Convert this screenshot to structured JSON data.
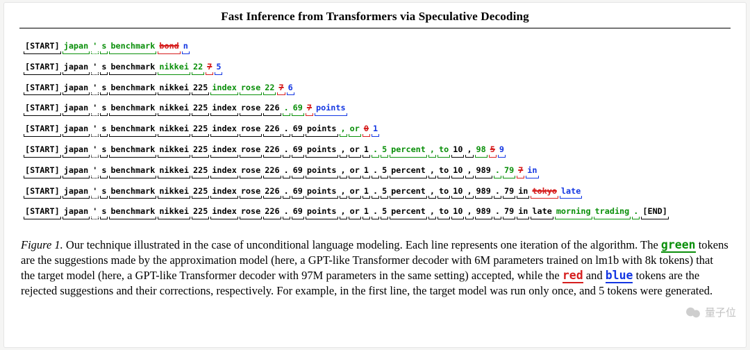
{
  "title": "Fast Inference from Transformers via Speculative Decoding",
  "watermark": "量子位",
  "caption": {
    "label": "Figure 1.",
    "parts": [
      " Our technique illustrated in the case of unconditional language modeling. Each line represents one iteration of the algorithm. The ",
      {
        "kw": "green",
        "color": "green"
      },
      " tokens are the suggestions made by the approximation model (here, a GPT-like Transformer decoder with 6M parameters trained on lm1b with 8k tokens) that the target model (here, a GPT-like Transformer decoder with 97M parameters in the same setting) accepted, while the ",
      {
        "kw": "red",
        "color": "red"
      },
      " and ",
      {
        "kw": "blue",
        "color": "blue"
      },
      " tokens are the rejected suggestions and their corrections, respectively. For example, in the first line, the target model was run only once, and 5 tokens were generated."
    ]
  },
  "lines": [
    [
      {
        "t": "[START]",
        "c": "black"
      },
      {
        "t": "japan",
        "c": "green"
      },
      {
        "t": "'",
        "c": "green",
        "dash": true
      },
      {
        "t": "s",
        "c": "green"
      },
      {
        "t": "benchmark",
        "c": "green"
      },
      {
        "t": "bond",
        "c": "red",
        "strike": true
      },
      {
        "t": "n",
        "c": "blue"
      }
    ],
    [
      {
        "t": "[START]",
        "c": "black"
      },
      {
        "t": "japan",
        "c": "black"
      },
      {
        "t": "'",
        "c": "black",
        "dash": true
      },
      {
        "t": "s",
        "c": "black"
      },
      {
        "t": "benchmark",
        "c": "black"
      },
      {
        "t": "nikkei",
        "c": "green"
      },
      {
        "t": "22",
        "c": "green"
      },
      {
        "t": "7",
        "c": "red",
        "strike": true
      },
      {
        "t": "5",
        "c": "blue"
      }
    ],
    [
      {
        "t": "[START]",
        "c": "black"
      },
      {
        "t": "japan",
        "c": "black"
      },
      {
        "t": "'",
        "c": "black",
        "dash": true
      },
      {
        "t": "s",
        "c": "black"
      },
      {
        "t": "benchmark",
        "c": "black"
      },
      {
        "t": "nikkei",
        "c": "black"
      },
      {
        "t": "225",
        "c": "black"
      },
      {
        "t": "index",
        "c": "green"
      },
      {
        "t": "rose",
        "c": "green"
      },
      {
        "t": "22",
        "c": "green"
      },
      {
        "t": "7",
        "c": "red",
        "strike": true
      },
      {
        "t": "6",
        "c": "blue"
      }
    ],
    [
      {
        "t": "[START]",
        "c": "black"
      },
      {
        "t": "japan",
        "c": "black"
      },
      {
        "t": "'",
        "c": "black",
        "dash": true
      },
      {
        "t": "s",
        "c": "black"
      },
      {
        "t": "benchmark",
        "c": "black"
      },
      {
        "t": "nikkei",
        "c": "black"
      },
      {
        "t": "225",
        "c": "black"
      },
      {
        "t": "index",
        "c": "black"
      },
      {
        "t": "rose",
        "c": "black"
      },
      {
        "t": "226",
        "c": "black"
      },
      {
        "t": ".",
        "c": "green"
      },
      {
        "t": "69",
        "c": "green"
      },
      {
        "t": "7",
        "c": "red",
        "strike": true
      },
      {
        "t": "points",
        "c": "blue"
      }
    ],
    [
      {
        "t": "[START]",
        "c": "black"
      },
      {
        "t": "japan",
        "c": "black"
      },
      {
        "t": "'",
        "c": "black",
        "dash": true
      },
      {
        "t": "s",
        "c": "black"
      },
      {
        "t": "benchmark",
        "c": "black"
      },
      {
        "t": "nikkei",
        "c": "black"
      },
      {
        "t": "225",
        "c": "black"
      },
      {
        "t": "index",
        "c": "black"
      },
      {
        "t": "rose",
        "c": "black"
      },
      {
        "t": "226",
        "c": "black"
      },
      {
        "t": ".",
        "c": "black"
      },
      {
        "t": "69",
        "c": "black"
      },
      {
        "t": "points",
        "c": "black"
      },
      {
        "t": ",",
        "c": "green"
      },
      {
        "t": "or",
        "c": "green"
      },
      {
        "t": "0",
        "c": "red",
        "strike": true
      },
      {
        "t": "1",
        "c": "blue"
      }
    ],
    [
      {
        "t": "[START]",
        "c": "black"
      },
      {
        "t": "japan",
        "c": "black"
      },
      {
        "t": "'",
        "c": "black",
        "dash": true
      },
      {
        "t": "s",
        "c": "black"
      },
      {
        "t": "benchmark",
        "c": "black"
      },
      {
        "t": "nikkei",
        "c": "black"
      },
      {
        "t": "225",
        "c": "black"
      },
      {
        "t": "index",
        "c": "black"
      },
      {
        "t": "rose",
        "c": "black"
      },
      {
        "t": "226",
        "c": "black"
      },
      {
        "t": ".",
        "c": "black"
      },
      {
        "t": "69",
        "c": "black"
      },
      {
        "t": "points",
        "c": "black"
      },
      {
        "t": ",",
        "c": "black"
      },
      {
        "t": "or",
        "c": "black"
      },
      {
        "t": "1",
        "c": "black"
      },
      {
        "t": ".",
        "c": "green"
      },
      {
        "t": "5",
        "c": "green"
      },
      {
        "t": "percent",
        "c": "green"
      },
      {
        "t": ",",
        "c": "green"
      },
      {
        "t": "to",
        "c": "green"
      },
      {
        "t": "10",
        "c": "black"
      },
      {
        "t": ",",
        "c": "black"
      },
      {
        "t": "98",
        "c": "green"
      },
      {
        "t": "5",
        "c": "red",
        "strike": true
      },
      {
        "t": "9",
        "c": "blue"
      }
    ],
    [
      {
        "t": "[START]",
        "c": "black"
      },
      {
        "t": "japan",
        "c": "black"
      },
      {
        "t": "'",
        "c": "black",
        "dash": true
      },
      {
        "t": "s",
        "c": "black"
      },
      {
        "t": "benchmark",
        "c": "black"
      },
      {
        "t": "nikkei",
        "c": "black"
      },
      {
        "t": "225",
        "c": "black"
      },
      {
        "t": "index",
        "c": "black"
      },
      {
        "t": "rose",
        "c": "black"
      },
      {
        "t": "226",
        "c": "black"
      },
      {
        "t": ".",
        "c": "black"
      },
      {
        "t": "69",
        "c": "black"
      },
      {
        "t": "points",
        "c": "black"
      },
      {
        "t": ",",
        "c": "black"
      },
      {
        "t": "or",
        "c": "black"
      },
      {
        "t": "1",
        "c": "black"
      },
      {
        "t": ".",
        "c": "black"
      },
      {
        "t": "5",
        "c": "black"
      },
      {
        "t": "percent",
        "c": "black"
      },
      {
        "t": ",",
        "c": "black"
      },
      {
        "t": "to",
        "c": "black"
      },
      {
        "t": "10",
        "c": "black"
      },
      {
        "t": ",",
        "c": "black"
      },
      {
        "t": "989",
        "c": "black"
      },
      {
        "t": ".",
        "c": "green"
      },
      {
        "t": "79",
        "c": "green"
      },
      {
        "t": "7",
        "c": "red",
        "strike": true
      },
      {
        "t": "in",
        "c": "blue"
      }
    ],
    [
      {
        "t": "[START]",
        "c": "black"
      },
      {
        "t": "japan",
        "c": "black"
      },
      {
        "t": "'",
        "c": "black",
        "dash": true
      },
      {
        "t": "s",
        "c": "black"
      },
      {
        "t": "benchmark",
        "c": "black"
      },
      {
        "t": "nikkei",
        "c": "black"
      },
      {
        "t": "225",
        "c": "black"
      },
      {
        "t": "index",
        "c": "black"
      },
      {
        "t": "rose",
        "c": "black"
      },
      {
        "t": "226",
        "c": "black"
      },
      {
        "t": ".",
        "c": "black"
      },
      {
        "t": "69",
        "c": "black"
      },
      {
        "t": "points",
        "c": "black"
      },
      {
        "t": ",",
        "c": "black"
      },
      {
        "t": "or",
        "c": "black"
      },
      {
        "t": "1",
        "c": "black"
      },
      {
        "t": ".",
        "c": "black"
      },
      {
        "t": "5",
        "c": "black"
      },
      {
        "t": "percent",
        "c": "black"
      },
      {
        "t": ",",
        "c": "black"
      },
      {
        "t": "to",
        "c": "black"
      },
      {
        "t": "10",
        "c": "black"
      },
      {
        "t": ",",
        "c": "black"
      },
      {
        "t": "989",
        "c": "black"
      },
      {
        "t": ".",
        "c": "black"
      },
      {
        "t": "79",
        "c": "black"
      },
      {
        "t": "in",
        "c": "black"
      },
      {
        "t": "tokyo",
        "c": "red",
        "strike": true
      },
      {
        "t": "late",
        "c": "blue"
      }
    ],
    [
      {
        "t": "[START]",
        "c": "black"
      },
      {
        "t": "japan",
        "c": "black"
      },
      {
        "t": "'",
        "c": "black",
        "dash": true
      },
      {
        "t": "s",
        "c": "black"
      },
      {
        "t": "benchmark",
        "c": "black"
      },
      {
        "t": "nikkei",
        "c": "black"
      },
      {
        "t": "225",
        "c": "black"
      },
      {
        "t": "index",
        "c": "black"
      },
      {
        "t": "rose",
        "c": "black"
      },
      {
        "t": "226",
        "c": "black"
      },
      {
        "t": ".",
        "c": "black"
      },
      {
        "t": "69",
        "c": "black"
      },
      {
        "t": "points",
        "c": "black"
      },
      {
        "t": ",",
        "c": "black"
      },
      {
        "t": "or",
        "c": "black"
      },
      {
        "t": "1",
        "c": "black"
      },
      {
        "t": ".",
        "c": "black"
      },
      {
        "t": "5",
        "c": "black"
      },
      {
        "t": "percent",
        "c": "black"
      },
      {
        "t": ",",
        "c": "black"
      },
      {
        "t": "to",
        "c": "black"
      },
      {
        "t": "10",
        "c": "black"
      },
      {
        "t": ",",
        "c": "black"
      },
      {
        "t": "989",
        "c": "black"
      },
      {
        "t": ".",
        "c": "black"
      },
      {
        "t": "79",
        "c": "black"
      },
      {
        "t": "in",
        "c": "black"
      },
      {
        "t": "late",
        "c": "black"
      },
      {
        "t": "morning",
        "c": "green"
      },
      {
        "t": "trading",
        "c": "green"
      },
      {
        "t": ".",
        "c": "green"
      },
      {
        "t": "[END]",
        "c": "black"
      }
    ]
  ]
}
